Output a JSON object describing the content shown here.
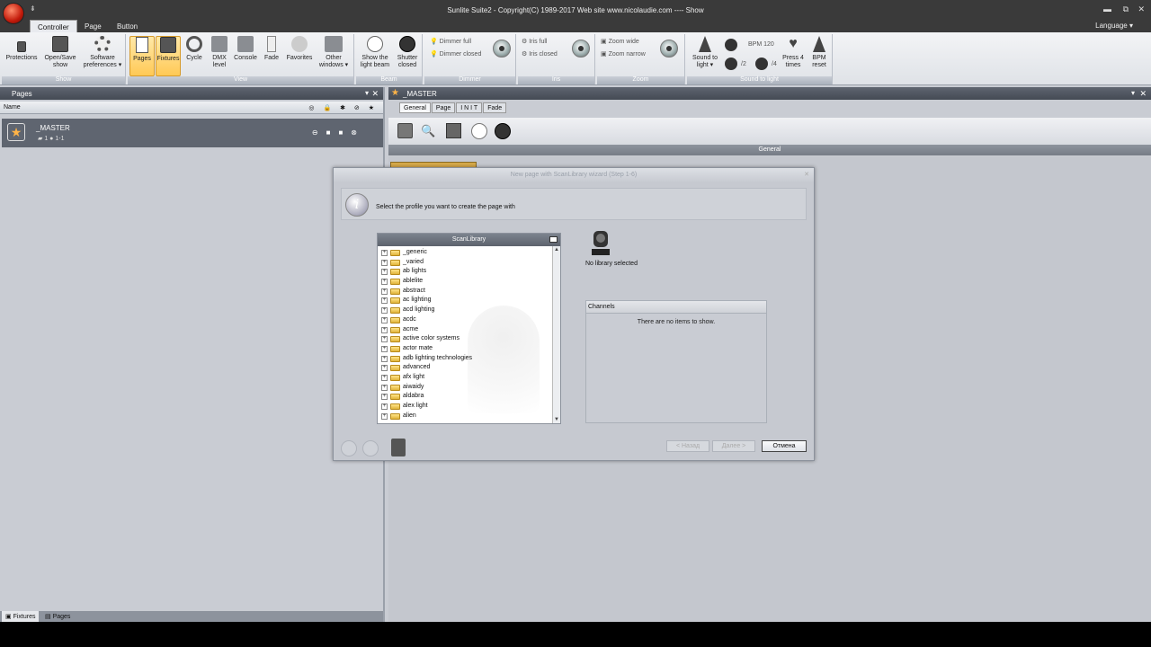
{
  "window": {
    "title": "Sunlite Suite2 - Copyright(C) 1989-2017    Web site www.nicolaudie.com ---- Show",
    "quick_access": "⇟",
    "minimize": "▬",
    "restore": "⧉",
    "close": "✕"
  },
  "ribbon_tabs": [
    "Controller",
    "Page",
    "Button"
  ],
  "language": "Language ▾",
  "ribbon": {
    "show_group": {
      "caption": "Show",
      "buttons": [
        "Protections",
        "Open/Save show",
        "Software preferences ▾"
      ]
    },
    "view_group": {
      "caption": "View",
      "buttons": [
        "Pages",
        "Fixtures",
        "Cycle",
        "DMX level",
        "Console",
        "Fade",
        "Favorites",
        "Other windows ▾"
      ]
    },
    "beam_group": {
      "caption": "Beam",
      "buttons": [
        "Show the light beam",
        "Shutter closed"
      ]
    },
    "dimmer_group": {
      "caption": "Dimmer",
      "items": [
        "Dimmer full",
        "Dimmer closed"
      ]
    },
    "iris_group": {
      "caption": "Iris",
      "items": [
        "Iris full",
        "Iris closed"
      ]
    },
    "zoom_group": {
      "caption": "Zoom",
      "items": [
        "Zoom wide",
        "Zoom narrow"
      ]
    },
    "sound_group": {
      "caption": "Sound to light",
      "sound_btn": "Sound to light ▾",
      "bpm": "BPM 120",
      "div2": "/2",
      "div4": "/4",
      "press4": "Press 4 times",
      "bpm_reset": "BPM reset"
    }
  },
  "pages_panel": {
    "title": "Pages",
    "pin": "▾",
    "close": "✕",
    "column_name": "Name",
    "column_icons": "◎ 🔒 ✱ ⊘ ★",
    "master_name": "_MASTER",
    "master_sub": "▰ 1  ● 1-1",
    "master_icons": "⊖■■⊗",
    "bottom_tabs": [
      "Fixtures",
      "Pages"
    ]
  },
  "master_panel": {
    "title": "_MASTER",
    "pin": "▾",
    "close": "✕",
    "tabs": [
      "General",
      "Page",
      "I N I T",
      "Fade"
    ],
    "section_title": "General"
  },
  "dialog": {
    "title": "New page with ScanLibrary wizard (Step 1-6)",
    "close": "✕",
    "instruction": "Select the profile you want to create the page with",
    "scanlibrary_title": "ScanLibrary",
    "library_items": [
      "_generic",
      "_varied",
      "ab lights",
      "ablelite",
      "abstract",
      "ac lighting",
      "acd lighting",
      "acdc",
      "acme",
      "active color systems",
      "actor mate",
      "adb lighting technologies",
      "advanced",
      "afx light",
      "aiwaidy",
      "aldabra",
      "alex light",
      "alien"
    ],
    "no_library": "No library selected",
    "channels_header": "Channels",
    "channels_empty": "There are no items to show.",
    "back_label": "< Назад",
    "next_label": "Далее >",
    "cancel_label": "Отмена"
  }
}
